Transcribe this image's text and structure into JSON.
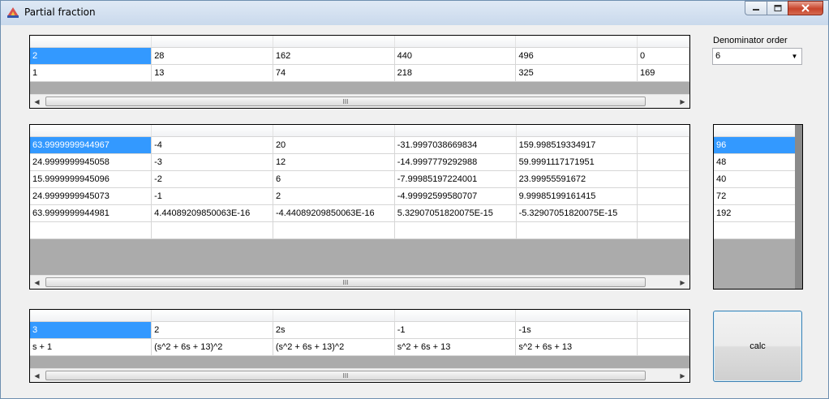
{
  "window": {
    "title": "Partial fraction"
  },
  "numerator_grid": {
    "rows": [
      [
        "2",
        "28",
        "162",
        "440",
        "496",
        "0"
      ],
      [
        "1",
        "13",
        "74",
        "218",
        "325",
        "169"
      ]
    ]
  },
  "coefficients_grid": {
    "rows": [
      [
        "63.9999999944967",
        "-4",
        "20",
        "-31.9997038669834",
        "159.998519334917",
        ""
      ],
      [
        "24.9999999945058",
        "-3",
        "12",
        "-14.9997779292988",
        "59.9991117171951",
        ""
      ],
      [
        "15.9999999945096",
        "-2",
        "6",
        "-7.99985197224001",
        "23.99955591672",
        ""
      ],
      [
        "24.9999999945073",
        "-1",
        "2",
        "-4.99992599580707",
        "9.99985199161415",
        ""
      ],
      [
        "63.9999999944981",
        "4.44089209850063E-16",
        "-4.44089209850063E-16",
        "5.32907051820075E-15",
        "-5.32907051820075E-15",
        ""
      ],
      [
        "",
        "",
        "",
        "",
        "",
        ""
      ]
    ]
  },
  "result_column_grid": {
    "rows": [
      "96",
      "48",
      "40",
      "72",
      "192",
      ""
    ]
  },
  "fractions_grid": {
    "rows": [
      [
        "3",
        "2",
        "2s",
        "-1",
        "-1s",
        ""
      ],
      [
        "s + 1",
        "(s^2 + 6s + 13)^2",
        "(s^2 + 6s + 13)^2",
        "s^2 + 6s + 13",
        "s^2 + 6s + 13",
        ""
      ]
    ]
  },
  "denominator_order": {
    "label": "Denominator order",
    "value": "6"
  },
  "calc_button": {
    "label": "calc"
  },
  "scroll_thumb_grip": "III"
}
